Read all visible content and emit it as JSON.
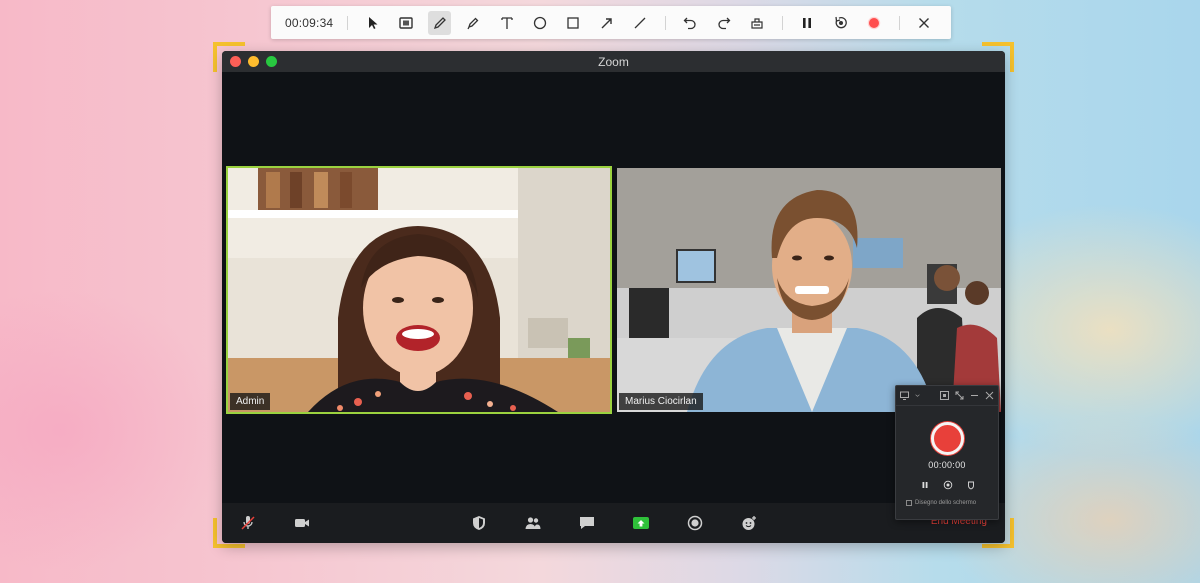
{
  "recorder_toolbar": {
    "elapsed": "00:09:34",
    "tools": [
      {
        "name": "cursor-icon"
      },
      {
        "name": "screenshot-icon"
      },
      {
        "name": "pen-icon",
        "active": true
      },
      {
        "name": "highlighter-icon"
      },
      {
        "name": "text-icon"
      },
      {
        "name": "ellipse-icon"
      },
      {
        "name": "rectangle-icon"
      },
      {
        "name": "arrow-icon"
      },
      {
        "name": "line-icon"
      },
      {
        "name": "undo-icon"
      },
      {
        "name": "redo-icon"
      },
      {
        "name": "clear-icon"
      },
      {
        "name": "pause-icon"
      },
      {
        "name": "restart-icon"
      },
      {
        "name": "record-icon"
      },
      {
        "name": "close-icon"
      }
    ],
    "record_color": "#ff4d4d"
  },
  "zoom_window": {
    "title": "Zoom",
    "participants": [
      {
        "name": "Admin",
        "active_speaker": true
      },
      {
        "name": "Marius Ciocirlan",
        "active_speaker": false
      }
    ],
    "bottom_bar": {
      "icons": [
        "mic-muted-icon",
        "video-camera-icon",
        "security-shield-icon",
        "participants-icon",
        "chat-icon",
        "share-screen-icon",
        "record-icon",
        "reactions-icon"
      ],
      "end_meeting": "End Meeting"
    },
    "colors": {
      "active_speaker_border": "#9bd23f",
      "share_green": "#2fc13a",
      "end_meeting_red": "#e8403a"
    }
  },
  "mini_recorder": {
    "time": "00:00:00",
    "option_label": "Disegno dello schermo"
  },
  "capture_frame_color": "#f5c12e"
}
